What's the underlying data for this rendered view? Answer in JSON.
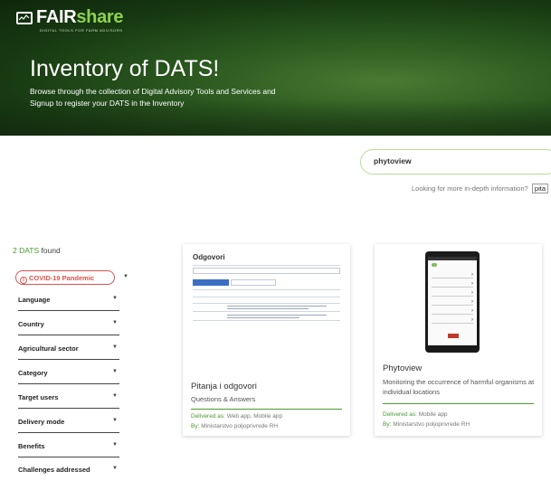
{
  "brand": {
    "name_a": "FAIR",
    "name_b": "share",
    "tagline": "DIGITAL TOOLS FOR FARM ADVISORS"
  },
  "hero": {
    "title": "Inventory of DATS!",
    "subtitle": "Browse through the collection of Digital Advisory Tools and Services and Signup to register your DATS in the Inventory"
  },
  "search": {
    "value": "phytoview",
    "more_info_text": "Looking for more in-depth information?",
    "more_info_input": "pita"
  },
  "results": {
    "count": "2 DATS",
    "count_suffix": " found"
  },
  "filters": [
    {
      "label": "COVID-19 Pandemic"
    },
    {
      "label": "Language"
    },
    {
      "label": "Country"
    },
    {
      "label": "Agricultural sector"
    },
    {
      "label": "Category"
    },
    {
      "label": "Target users"
    },
    {
      "label": "Delivery mode"
    },
    {
      "label": "Benefits"
    },
    {
      "label": "Challenges addressed"
    }
  ],
  "cards": [
    {
      "shot_title": "Odgovori",
      "title": "Pitanja i odgovori",
      "desc": "Questions & Answers",
      "delivered_label": "Delivered as:",
      "delivered_value": "Web app, Mobile app",
      "by_label": "By:",
      "by_value": "Ministarstvo poljoprivrede RH"
    },
    {
      "title": "Phytoview",
      "desc": "Monitoring the occurrence of harmful organisms at individual locations",
      "delivered_label": "Delivered as:",
      "delivered_value": "Mobile app",
      "by_label": "By:",
      "by_value": "Ministarstvo poljoprivrede RH"
    }
  ],
  "colors": {
    "accent": "#4a9a2c",
    "covid": "#d9534f",
    "search_border": "#b9dc95"
  }
}
